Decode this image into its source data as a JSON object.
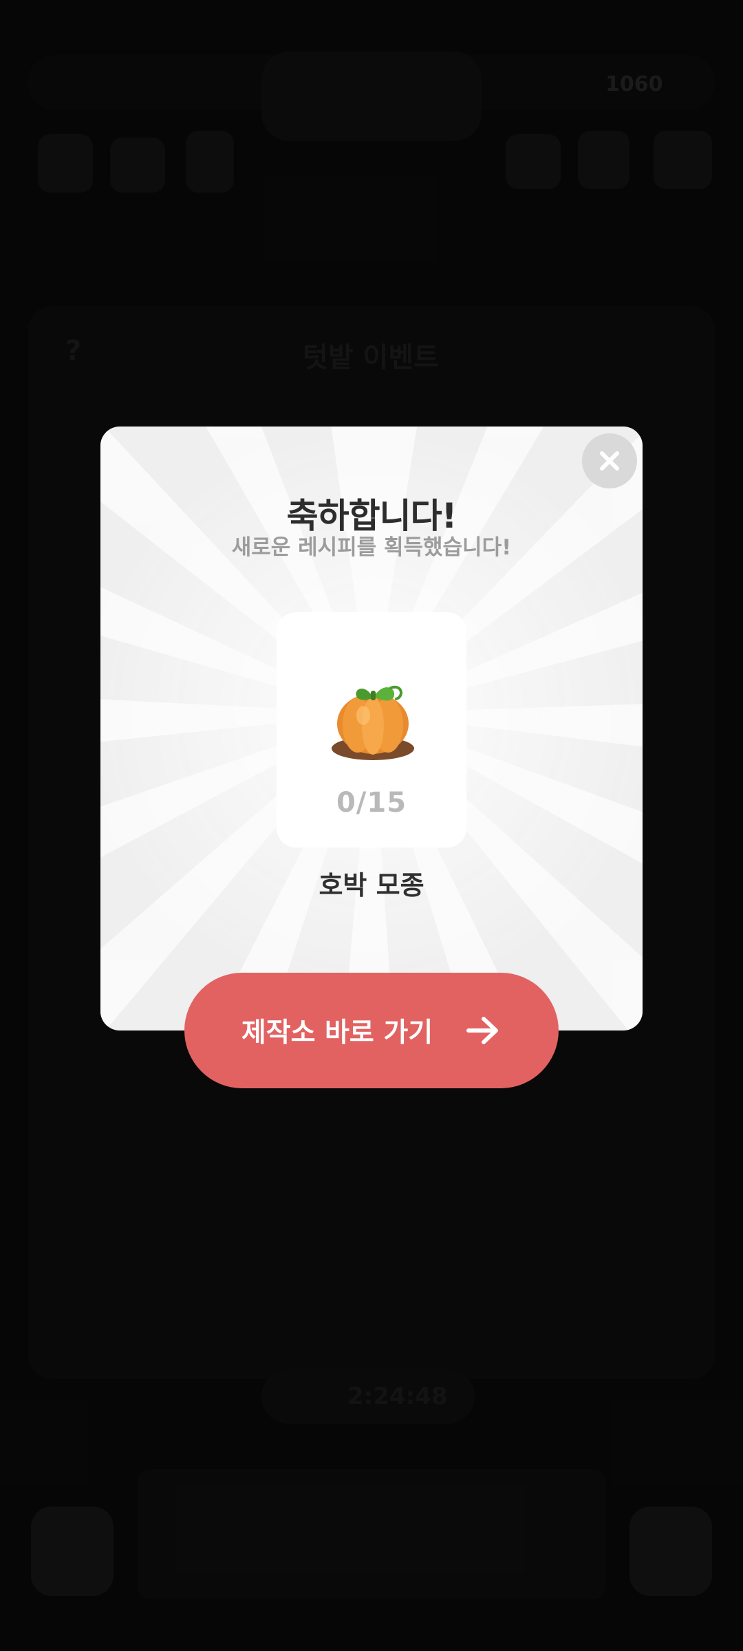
{
  "background": {
    "event_title": "텃밭 이벤트",
    "timer": "2:24:48",
    "coins": "1060"
  },
  "modal": {
    "title": "축하합니다!",
    "subtitle": "새로운 레시피를 획득했습니다!",
    "item": {
      "icon": "pumpkin-seedling",
      "count": "0/15",
      "name": "호박 모종"
    },
    "close_icon": "close",
    "action_button": {
      "label": "제작소 바로 가기",
      "icon": "arrow-right"
    }
  },
  "colors": {
    "accent": "#e26261",
    "modal_bg": "#efefef"
  }
}
